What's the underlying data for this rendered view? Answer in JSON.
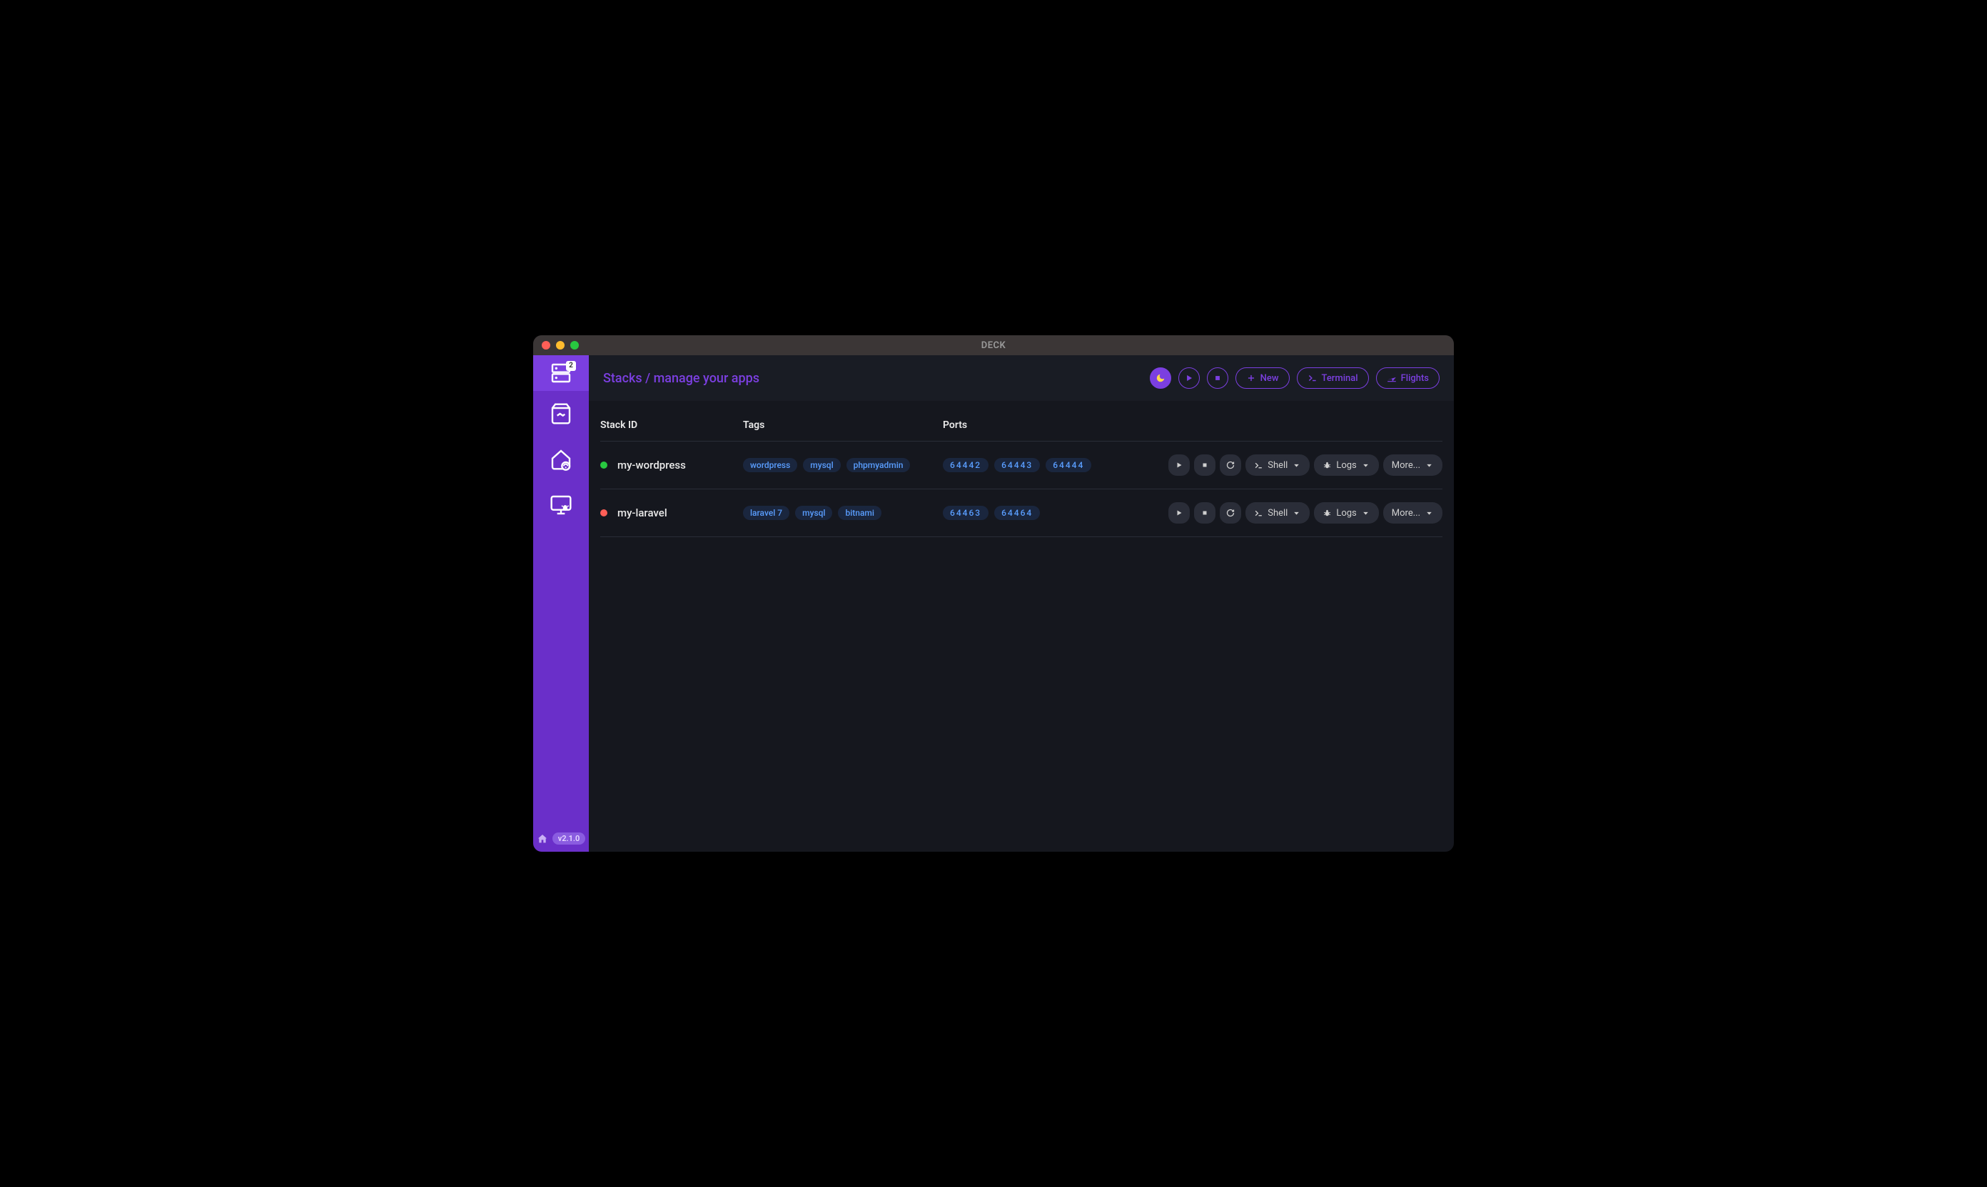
{
  "window": {
    "title": "DECK"
  },
  "sidebar": {
    "badge_count": "2",
    "version": "v2.1.0"
  },
  "header": {
    "breadcrumb": "Stacks / manage your apps",
    "actions": {
      "new": "New",
      "terminal": "Terminal",
      "flights": "Flights"
    }
  },
  "table": {
    "columns": {
      "stack_id": "Stack ID",
      "tags": "Tags",
      "ports": "Ports"
    },
    "rows": [
      {
        "status": "green",
        "id": "my-wordpress",
        "tags": [
          "wordpress",
          "mysql",
          "phpmyadmin"
        ],
        "ports": [
          "64442",
          "64443",
          "64444"
        ]
      },
      {
        "status": "red",
        "id": "my-laravel",
        "tags": [
          "laravel 7",
          "mysql",
          "bitnami"
        ],
        "ports": [
          "64463",
          "64464"
        ]
      }
    ],
    "actions": {
      "shell": "Shell",
      "logs": "Logs",
      "more": "More..."
    }
  }
}
